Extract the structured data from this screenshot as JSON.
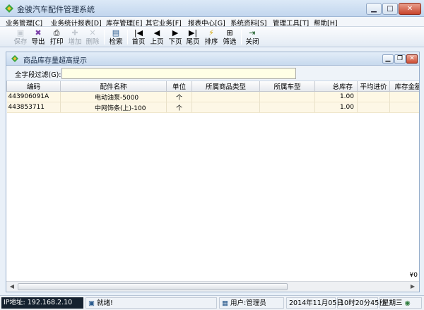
{
  "window": {
    "title": "金骏汽车配件管理系统",
    "min_label": "▁",
    "max_label": "□",
    "close_label": "✕"
  },
  "menu": [
    "业务管理[C]",
    "业务统计报表[D]",
    "库存管理[E]",
    "其它业务[F]",
    "报表中心[G]",
    "系统资料[S]",
    "管理工具[T]",
    "帮助[H]"
  ],
  "toolbar": {
    "save": "保存",
    "export": "导出",
    "print": "打印",
    "add": "增加",
    "delete": "删除",
    "search": "检索",
    "first": "首页",
    "prev": "上页",
    "next": "下页",
    "last": "尾页",
    "sort": "排序",
    "filter": "筛选",
    "close": "关闭"
  },
  "icons": {
    "save": "save-icon",
    "export": "export-icon",
    "print": "printer-icon",
    "add": "add-icon",
    "delete": "delete-icon",
    "search": "search-icon",
    "first": "first-page-icon",
    "prev": "prev-page-icon",
    "next": "next-page-icon",
    "last": "last-page-icon",
    "sort": "sort-icon",
    "filter": "filter-icon",
    "close": "close-icon"
  },
  "child_window": {
    "title": "商品库存量超高提示"
  },
  "filter": {
    "label": "全字段过滤(G):",
    "value": ""
  },
  "table": {
    "columns": [
      "编码",
      "配件名称",
      "单位",
      "所属商品类型",
      "所属车型",
      "总库存",
      "平均进价",
      "库存金额"
    ],
    "rows": [
      [
        "443906091A",
        "电动油泵-5000",
        "个",
        "",
        "",
        "1.00",
        "",
        ""
      ],
      [
        "443853711",
        "中网饰条(上)-100",
        "个",
        "",
        "",
        "1.00",
        "",
        ""
      ]
    ],
    "total": "¥0"
  },
  "status": {
    "ip": "IP地址: 192.168.2.10",
    "ready": "就绪!",
    "user": "用户:管理员",
    "date": "2014年11月05日",
    "time": "10时20分45秒",
    "week": "星期三"
  },
  "colors": {
    "accent": "#c7d9ee",
    "row_bg": "#fdf7e6",
    "filter_bg": "#ffffe6",
    "close_red": "#c8452c"
  }
}
